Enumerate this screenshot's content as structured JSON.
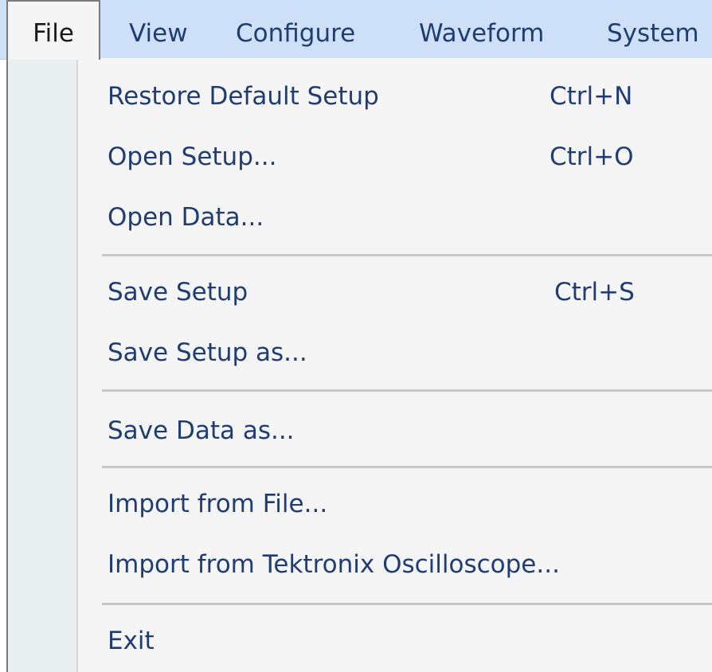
{
  "menubar": {
    "items": [
      {
        "label": "File"
      },
      {
        "label": "View"
      },
      {
        "label": "Configure"
      },
      {
        "label": "Waveform"
      },
      {
        "label": "System"
      }
    ],
    "active": "File"
  },
  "file_menu": {
    "items": [
      {
        "label": "Restore Default Setup",
        "shortcut": "Ctrl+N"
      },
      {
        "label": "Open Setup...",
        "shortcut": "Ctrl+O"
      },
      {
        "label": "Open Data...",
        "shortcut": ""
      },
      {
        "label": "Save Setup",
        "shortcut": "Ctrl+S"
      },
      {
        "label": "Save Setup as...",
        "shortcut": ""
      },
      {
        "label": "Save Data as...",
        "shortcut": ""
      },
      {
        "label": "Import from File...",
        "shortcut": ""
      },
      {
        "label": "Import from Tektronix Oscilloscope...",
        "shortcut": ""
      },
      {
        "label": "Exit",
        "shortcut": ""
      }
    ]
  },
  "colors": {
    "menubar_bg": "#cde0f7",
    "menu_text": "#1f3d73",
    "dropdown_bg": "#f5f5f5",
    "gutter_bg": "#e9eef0",
    "separator": "#c8c8c8"
  }
}
